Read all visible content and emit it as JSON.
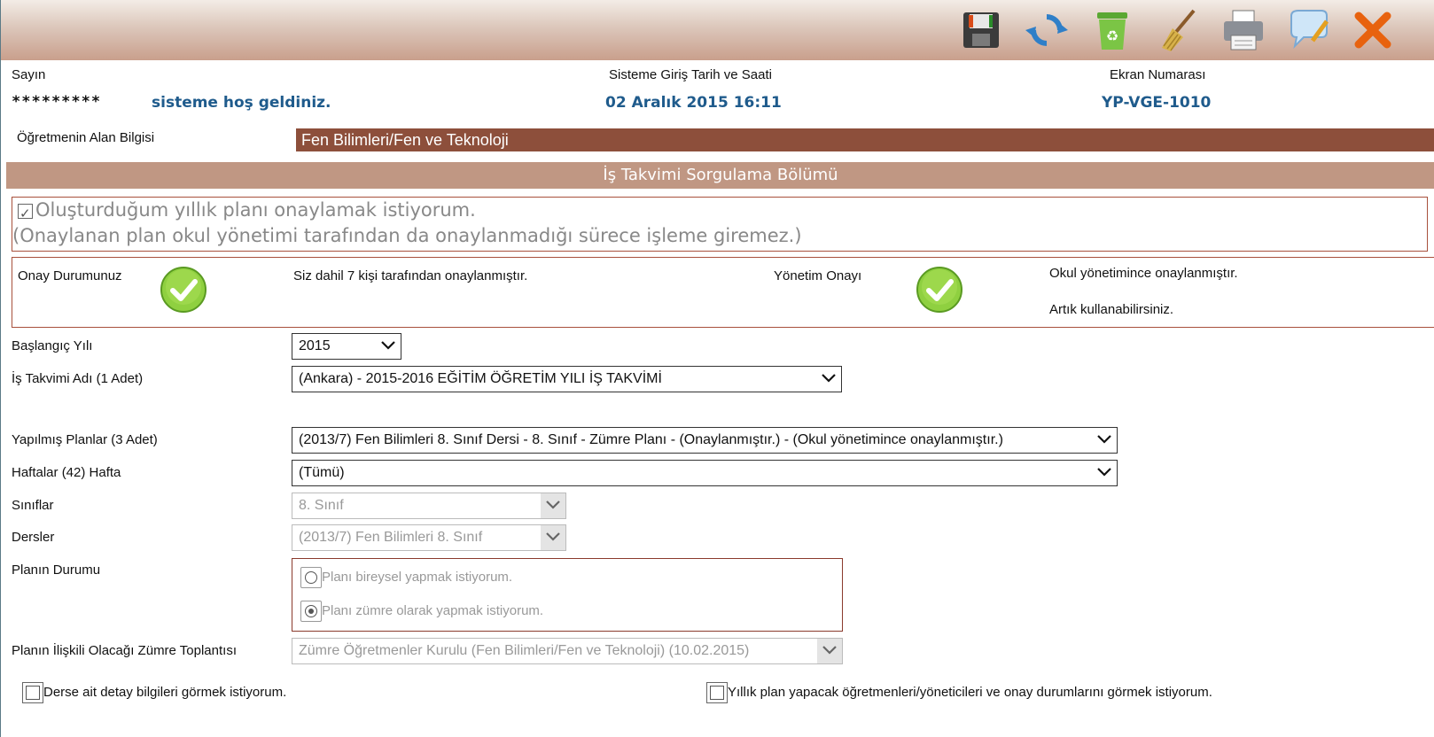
{
  "toolbar": {
    "icons": [
      "save-icon",
      "refresh-icon",
      "recycle-bin-icon",
      "broom-icon",
      "printer-icon",
      "comment-icon",
      "close-icon"
    ]
  },
  "header": {
    "sayin_label": "Sayın",
    "masked_name": "*********",
    "welcome": "sisteme hoş geldiniz.",
    "login_label": "Sisteme Giriş Tarih ve Saati",
    "login_value": "02 Aralık 2015 16:11",
    "screen_label": "Ekran Numarası",
    "screen_value": "YP-VGE-1010"
  },
  "alan": {
    "label": "Öğretmenin Alan Bilgisi",
    "value": "Fen Bilimleri/Fen ve Teknoloji"
  },
  "section_title": "İş Takvimi Sorgulama Bölümü",
  "approve": {
    "line1": "Oluşturduğum yıllık planı onaylamak istiyorum.",
    "line2": "(Onaylanan plan okul yönetimi tarafından da onaylanmadığı sürece işleme giremez.)",
    "checked": true
  },
  "status": {
    "onay_label": "Onay Durumunuz",
    "onay_text": "Siz dahil 7 kişi tarafından onaylanmıştır.",
    "yonetim_label": "Yönetim Onayı",
    "yonetim_text1": "Okul yönetimince onaylanmıştır.",
    "yonetim_text2": "Artık kullanabilirsiniz.",
    "ok_color": "#7cc230"
  },
  "form": {
    "baslangic_label": "Başlangıç Yılı",
    "baslangic_value": "2015",
    "takvim_label": "İş Takvimi Adı (1 Adet)",
    "takvim_value": "(Ankara) - 2015-2016 EĞİTİM ÖĞRETİM YILI İŞ TAKVİMİ",
    "planlar_label": "Yapılmış Planlar (3 Adet)",
    "planlar_value": "(2013/7) Fen Bilimleri 8. Sınıf Dersi - 8. Sınıf - Zümre Planı - (Onaylanmıştır.) - (Okul yönetimince onaylanmıştır.)",
    "haftalar_label": "Haftalar (42) Hafta",
    "haftalar_value": "(Tümü)",
    "siniflar_label": "Sınıflar",
    "siniflar_value": "8. Sınıf",
    "dersler_label": "Dersler",
    "dersler_value": "(2013/7) Fen Bilimleri 8. Sınıf",
    "plan_durum_label": "Planın Durumu",
    "radio1": "Planı bireysel yapmak istiyorum.",
    "radio2": "Planı zümre olarak yapmak istiyorum.",
    "zumre_label": "Planın İlişkili Olacağı Zümre Toplantısı",
    "zumre_value": "Zümre Öğretmenler Kurulu (Fen Bilimleri/Fen ve Teknoloji) (10.02.2015)"
  },
  "bottom": {
    "detay": "Derse ait detay bilgileri görmek istiyorum.",
    "yillik": "Yıllık plan yapacak öğretmenleri/yöneticileri ve onay durumlarını görmek istiyorum."
  }
}
